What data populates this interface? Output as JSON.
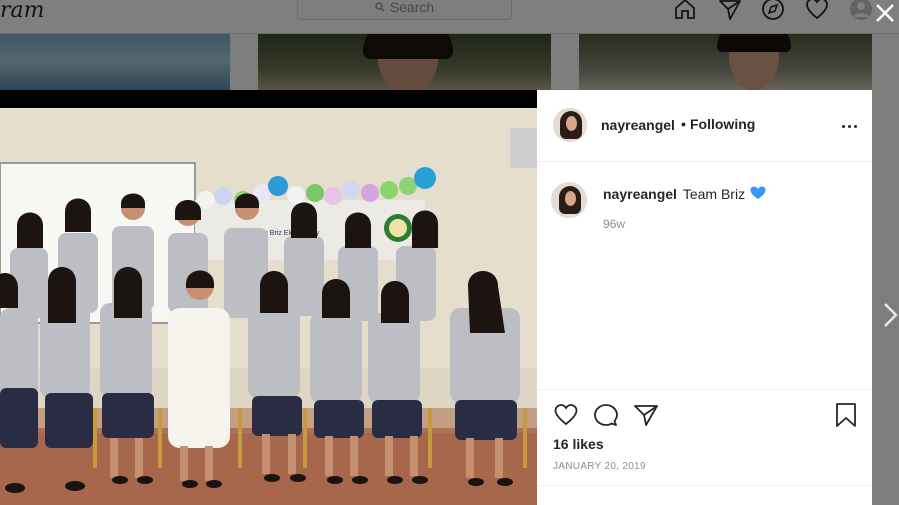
{
  "app": {
    "logo_text": "ram"
  },
  "search": {
    "label": "Search",
    "icon": "search-icon"
  },
  "nav": {
    "icons": [
      "home-icon",
      "direct-icon",
      "explore-icon",
      "activity-heart-icon",
      "profile-avatar"
    ]
  },
  "post": {
    "header": {
      "username": "nayreangel",
      "separator": "•",
      "follow_state": "Following"
    },
    "caption": {
      "username": "nayreangel",
      "text": "Team Briz",
      "emoji": "blue-heart-icon",
      "time_ago": "96w"
    },
    "likes": "16 likes",
    "date": "JANUARY 20, 2019",
    "photo": {
      "banner_text": "Don Briz Elementary"
    }
  },
  "colors": {
    "text": "#262626",
    "muted": "#8e8e8e",
    "border": "#efefef",
    "blue_heart": "#3897f0"
  }
}
